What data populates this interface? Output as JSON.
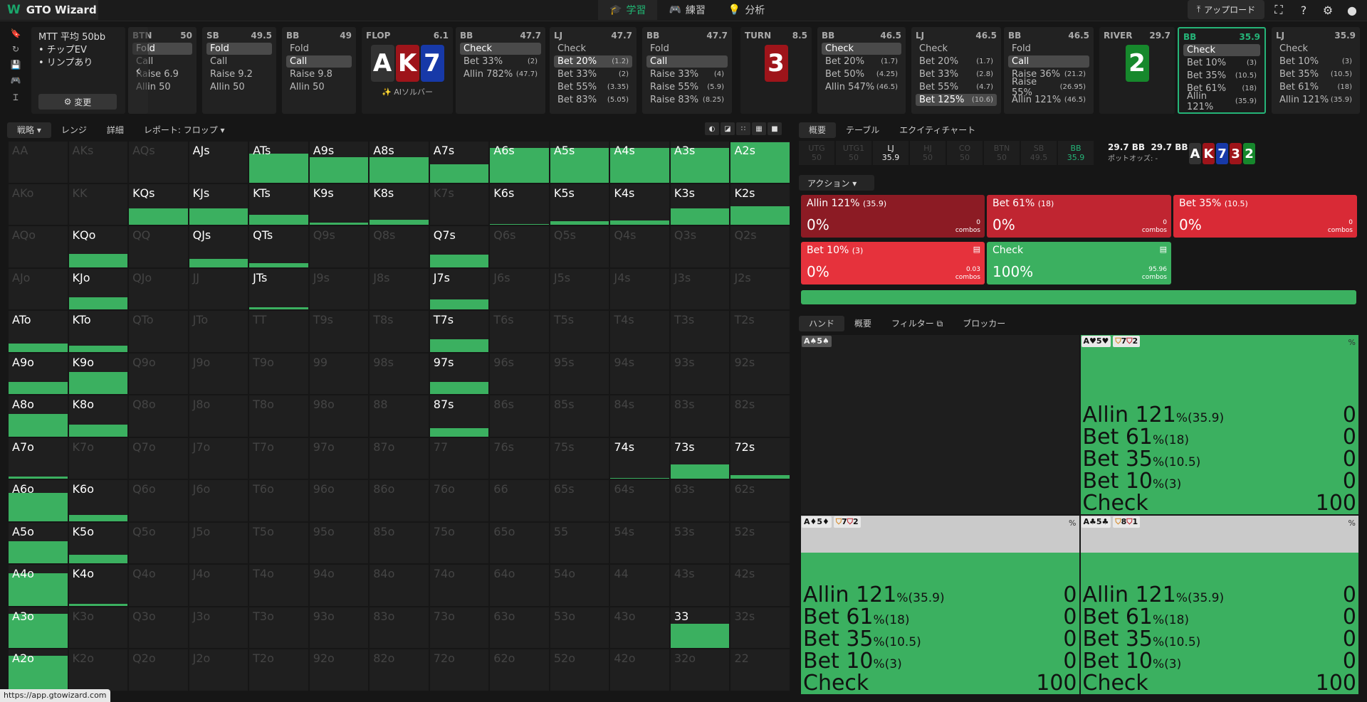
{
  "app": {
    "name": "GTO Wizard"
  },
  "nav": [
    {
      "label": "学習",
      "icon": "graduation-cap-icon"
    },
    {
      "label": "練習",
      "icon": "gamepad-icon"
    },
    {
      "label": "分析",
      "icon": "lightbulb-icon"
    }
  ],
  "upload_label": "アップロード",
  "mtt": {
    "title": "MTT 平均 50bb",
    "line1": "• チップEV",
    "line2": "• リンプあり",
    "change": "変更"
  },
  "nodes": [
    {
      "pos": "BTN",
      "stack": "50",
      "acts": [
        {
          "a": "Fold",
          "s": "",
          "hl": true
        },
        {
          "a": "Call",
          "s": ""
        },
        {
          "a": "Raise 6.9",
          "s": ""
        },
        {
          "a": "Allin 50",
          "s": ""
        }
      ]
    },
    {
      "pos": "SB",
      "stack": "49.5",
      "acts": [
        {
          "a": "Fold",
          "s": "",
          "hl": true
        },
        {
          "a": "Call",
          "s": ""
        },
        {
          "a": "Raise 9.2",
          "s": ""
        },
        {
          "a": "Allin 50",
          "s": ""
        }
      ]
    },
    {
      "pos": "BB",
      "stack": "49",
      "acts": [
        {
          "a": "Fold",
          "s": ""
        },
        {
          "a": "Call",
          "s": "",
          "hl": true
        },
        {
          "a": "Raise 9.8",
          "s": ""
        },
        {
          "a": "Allin 50",
          "s": ""
        }
      ]
    },
    {
      "pos": "BB",
      "stack": "47.7",
      "acts": [
        {
          "a": "Check",
          "s": "",
          "hl": true
        },
        {
          "a": "Bet 33%",
          "s": "(2)"
        },
        {
          "a": "Allin 782%",
          "s": "(47.7)"
        }
      ]
    },
    {
      "pos": "LJ",
      "stack": "47.7",
      "acts": [
        {
          "a": "Check",
          "s": ""
        },
        {
          "a": "Bet 20%",
          "s": "(1.2)",
          "hl": true
        },
        {
          "a": "Bet 33%",
          "s": "(2)"
        },
        {
          "a": "Bet 55%",
          "s": "(3.35)"
        },
        {
          "a": "Bet 83%",
          "s": "(5.05)"
        }
      ]
    },
    {
      "pos": "BB",
      "stack": "47.7",
      "acts": [
        {
          "a": "Fold",
          "s": ""
        },
        {
          "a": "Call",
          "s": "",
          "hl": true
        },
        {
          "a": "Raise 33%",
          "s": "(4)"
        },
        {
          "a": "Raise 55%",
          "s": "(5.9)"
        },
        {
          "a": "Raise 83%",
          "s": "(8.25)"
        }
      ]
    },
    {
      "pos": "BB",
      "stack": "46.5",
      "acts": [
        {
          "a": "Check",
          "s": "",
          "hl": true
        },
        {
          "a": "Bet 20%",
          "s": "(1.7)"
        },
        {
          "a": "Bet 50%",
          "s": "(4.25)"
        },
        {
          "a": "Allin 547%",
          "s": "(46.5)"
        }
      ]
    },
    {
      "pos": "LJ",
      "stack": "46.5",
      "acts": [
        {
          "a": "Check",
          "s": ""
        },
        {
          "a": "Bet 20%",
          "s": "(1.7)"
        },
        {
          "a": "Bet 33%",
          "s": "(2.8)"
        },
        {
          "a": "Bet 55%",
          "s": "(4.7)"
        },
        {
          "a": "Bet 125%",
          "s": "(10.6)",
          "hl": true
        }
      ]
    },
    {
      "pos": "BB",
      "stack": "46.5",
      "acts": [
        {
          "a": "Fold",
          "s": ""
        },
        {
          "a": "Call",
          "s": "",
          "hl": true
        },
        {
          "a": "Raise 36%",
          "s": "(21.2)"
        },
        {
          "a": "Raise 55%",
          "s": "(26.95)"
        },
        {
          "a": "Allin 121%",
          "s": "(46.5)"
        }
      ]
    },
    {
      "pos": "BB",
      "stack": "35.9",
      "acts": [
        {
          "a": "Check",
          "s": "",
          "hl": true
        },
        {
          "a": "Bet 10%",
          "s": "(3)"
        },
        {
          "a": "Bet 35%",
          "s": "(10.5)"
        },
        {
          "a": "Bet 61%",
          "s": "(18)"
        },
        {
          "a": "Allin 121%",
          "s": "(35.9)"
        }
      ]
    },
    {
      "pos": "LJ",
      "stack": "35.9",
      "acts": [
        {
          "a": "Check",
          "s": ""
        },
        {
          "a": "Bet 10%",
          "s": "(3)"
        },
        {
          "a": "Bet 35%",
          "s": "(10.5)"
        },
        {
          "a": "Bet 61%",
          "s": "(18)"
        },
        {
          "a": "Allin 121%",
          "s": "(35.9)"
        }
      ]
    }
  ],
  "streets": {
    "flop": {
      "name": "FLOP",
      "pot": "6.1",
      "cards": [
        {
          "r": "A",
          "s": "s"
        },
        {
          "r": "K",
          "s": "h"
        },
        {
          "r": "7",
          "s": "d"
        }
      ],
      "ai": "AIソルバー"
    },
    "turn": {
      "name": "TURN",
      "pot": "8.5",
      "cards": [
        {
          "r": "3",
          "s": "h"
        }
      ]
    },
    "river": {
      "name": "RIVER",
      "pot": "29.7",
      "cards": [
        {
          "r": "2",
          "s": "c"
        }
      ]
    }
  },
  "left_tabs": [
    {
      "label": "戦略 ▾"
    },
    {
      "label": "レンジ"
    },
    {
      "label": "詳細"
    },
    {
      "label": "レポート: フロップ ▾"
    }
  ],
  "matrix": {
    "labels": [
      [
        "AA",
        "AKs",
        "AQs",
        "AJs",
        "ATs",
        "A9s",
        "A8s",
        "A7s",
        "A6s",
        "A5s",
        "A4s",
        "A3s",
        "A2s"
      ],
      [
        "AKo",
        "KK",
        "KQs",
        "KJs",
        "KTs",
        "K9s",
        "K8s",
        "K7s",
        "K6s",
        "K5s",
        "K4s",
        "K3s",
        "K2s"
      ],
      [
        "AQo",
        "KQo",
        "QQ",
        "QJs",
        "QTs",
        "Q9s",
        "Q8s",
        "Q7s",
        "Q6s",
        "Q5s",
        "Q4s",
        "Q3s",
        "Q2s"
      ],
      [
        "AJo",
        "KJo",
        "QJo",
        "JJ",
        "JTs",
        "J9s",
        "J8s",
        "J7s",
        "J6s",
        "J5s",
        "J4s",
        "J3s",
        "J2s"
      ],
      [
        "ATo",
        "KTo",
        "QTo",
        "JTo",
        "TT",
        "T9s",
        "T8s",
        "T7s",
        "T6s",
        "T5s",
        "T4s",
        "T3s",
        "T2s"
      ],
      [
        "A9o",
        "K9o",
        "Q9o",
        "J9o",
        "T9o",
        "99",
        "98s",
        "97s",
        "96s",
        "95s",
        "94s",
        "93s",
        "92s"
      ],
      [
        "A8o",
        "K8o",
        "Q8o",
        "J8o",
        "T8o",
        "98o",
        "88",
        "87s",
        "86s",
        "85s",
        "84s",
        "83s",
        "82s"
      ],
      [
        "A7o",
        "K7o",
        "Q7o",
        "J7o",
        "T7o",
        "97o",
        "87o",
        "77",
        "76s",
        "75s",
        "74s",
        "73s",
        "72s"
      ],
      [
        "A6o",
        "K6o",
        "Q6o",
        "J6o",
        "T6o",
        "96o",
        "86o",
        "76o",
        "66",
        "65s",
        "64s",
        "63s",
        "62s"
      ],
      [
        "A5o",
        "K5o",
        "Q5o",
        "J5o",
        "T5o",
        "95o",
        "85o",
        "75o",
        "65o",
        "55",
        "54s",
        "53s",
        "52s"
      ],
      [
        "A4o",
        "K4o",
        "Q4o",
        "J4o",
        "T4o",
        "94o",
        "84o",
        "74o",
        "64o",
        "54o",
        "44",
        "43s",
        "42s"
      ],
      [
        "A3o",
        "K3o",
        "Q3o",
        "J3o",
        "T3o",
        "93o",
        "83o",
        "73o",
        "63o",
        "53o",
        "43o",
        "33",
        "32s"
      ],
      [
        "A2o",
        "K2o",
        "Q2o",
        "J2o",
        "T2o",
        "92o",
        "82o",
        "72o",
        "62o",
        "52o",
        "42o",
        "32o",
        "22"
      ]
    ],
    "fill": [
      [
        0,
        0,
        0,
        0,
        0.7,
        0.62,
        0.62,
        0.45,
        0.85,
        0.85,
        0.85,
        0.85,
        0.98
      ],
      [
        0,
        0,
        0.4,
        0.4,
        0.25,
        0.05,
        0.12,
        0,
        0.02,
        0.08,
        0.1,
        0.4,
        0.45
      ],
      [
        0,
        0.32,
        0,
        0.2,
        0.1,
        0,
        0,
        0.3,
        0,
        0,
        0,
        0,
        0
      ],
      [
        0,
        0.3,
        0,
        0,
        0.05,
        0,
        0,
        0.25,
        0,
        0,
        0,
        0,
        0
      ],
      [
        0.2,
        0.15,
        0,
        0,
        0,
        0,
        0,
        0.3,
        0,
        0,
        0,
        0,
        0
      ],
      [
        0.3,
        0.55,
        0,
        0,
        0,
        0,
        0,
        0.3,
        0,
        0,
        0,
        0,
        0
      ],
      [
        0.55,
        0.3,
        0,
        0,
        0,
        0,
        0,
        0.2,
        0,
        0,
        0,
        0,
        0
      ],
      [
        0.05,
        0,
        0,
        0,
        0,
        0,
        0,
        0,
        0,
        0,
        0.02,
        0.35,
        0.1
      ],
      [
        0.7,
        0.15,
        0,
        0,
        0,
        0,
        0,
        0,
        0,
        0,
        0,
        0,
        0
      ],
      [
        0.55,
        0.22,
        0,
        0,
        0,
        0,
        0,
        0,
        0,
        0,
        0,
        0,
        0
      ],
      [
        0.8,
        0.05,
        0,
        0,
        0,
        0,
        0,
        0,
        0,
        0,
        0,
        0,
        0
      ],
      [
        0.85,
        0,
        0,
        0,
        0,
        0,
        0,
        0,
        0,
        0,
        0,
        0.6,
        0
      ],
      [
        0.85,
        0,
        0,
        0,
        0,
        0,
        0,
        0,
        0,
        0,
        0,
        0,
        0
      ]
    ],
    "bright": [
      [
        3,
        4,
        5,
        6,
        7,
        8,
        9,
        10,
        11,
        12
      ],
      [
        2,
        3,
        4,
        5,
        6,
        8,
        9,
        10,
        11,
        12
      ],
      [
        1,
        3,
        4,
        7
      ],
      [
        1,
        4,
        7
      ],
      [
        0,
        1,
        7
      ],
      [
        0,
        1,
        7
      ],
      [
        0,
        1,
        7
      ],
      [
        0,
        10,
        11,
        12
      ],
      [
        0,
        1
      ],
      [
        0,
        1
      ],
      [
        0,
        1
      ],
      [
        0,
        11
      ],
      [
        0
      ]
    ]
  },
  "right_tabs": [
    {
      "label": "概要"
    },
    {
      "label": "テーブル"
    },
    {
      "label": "エクイティチャート"
    }
  ],
  "positions": [
    {
      "n": "UTG",
      "v": "50"
    },
    {
      "n": "UTG1",
      "v": "50"
    },
    {
      "n": "LJ",
      "v": "35.9"
    },
    {
      "n": "HJ",
      "v": "50"
    },
    {
      "n": "CO",
      "v": "50"
    },
    {
      "n": "BTN",
      "v": "50"
    },
    {
      "n": "SB",
      "v": "49.5"
    },
    {
      "n": "BB",
      "v": "35.9"
    }
  ],
  "pot": {
    "a": "29.7 BB",
    "b": "29.7 BB",
    "label": "ポットオッズ: -"
  },
  "board": [
    {
      "r": "A",
      "s": "s"
    },
    {
      "r": "K",
      "s": "h"
    },
    {
      "r": "7",
      "s": "d"
    },
    {
      "r": "3",
      "s": "h"
    },
    {
      "r": "2",
      "s": "c"
    }
  ],
  "action_dropdown": "アクション ▾",
  "actions": [
    {
      "t": "Allin 121%",
      "s": "(35.9)",
      "p": "0%",
      "c": "0",
      "color": "#8c1b24"
    },
    {
      "t": "Bet 61%",
      "s": "(18)",
      "p": "0%",
      "c": "0",
      "color": "#c02531"
    },
    {
      "t": "Bet 35%",
      "s": "(10.5)",
      "p": "0%",
      "c": "0",
      "color": "#d92a36"
    },
    {
      "t": "Bet 10%",
      "s": "(3)",
      "p": "0%",
      "c": "0.03",
      "color": "#e6323c"
    },
    {
      "t": "Check",
      "s": "",
      "p": "100%",
      "c": "95.96",
      "color": "#3bb060"
    }
  ],
  "combos_label": "combos",
  "hand_tabs": [
    {
      "label": "ハンド"
    },
    {
      "label": "概要"
    },
    {
      "label": "フィルター ⧉"
    },
    {
      "label": "ブロッカー"
    }
  ],
  "hands": [
    {
      "combo": "A♠5♠",
      "empty": true
    },
    {
      "combo": "A♥5♥",
      "b1": "7",
      "b2": "2",
      "pct": "%",
      "lines": [
        {
          "a": "Allin 121",
          "s": "%(35.9)",
          "v": "0"
        },
        {
          "a": "Bet 61",
          "s": "%(18)",
          "v": "0"
        },
        {
          "a": "Bet 35",
          "s": "%(10.5)",
          "v": "0"
        },
        {
          "a": "Bet 10",
          "s": "%(3)",
          "v": "0"
        },
        {
          "a": "Check",
          "s": "",
          "v": "100"
        }
      ]
    },
    {
      "combo": "A♦5♦",
      "b1": "7",
      "b2": "2",
      "pct": "%",
      "gray": true,
      "lines": [
        {
          "a": "Allin 121",
          "s": "%(35.9)",
          "v": "0"
        },
        {
          "a": "Bet 61",
          "s": "%(18)",
          "v": "0"
        },
        {
          "a": "Bet 35",
          "s": "%(10.5)",
          "v": "0"
        },
        {
          "a": "Bet 10",
          "s": "%(3)",
          "v": "0"
        },
        {
          "a": "Check",
          "s": "",
          "v": "100"
        }
      ]
    },
    {
      "combo": "A♣5♣",
      "b1": "8",
      "b2": "1",
      "pct": "%",
      "gray": true,
      "lines": [
        {
          "a": "Allin 121",
          "s": "%(35.9)",
          "v": "0"
        },
        {
          "a": "Bet 61",
          "s": "%(18)",
          "v": "0"
        },
        {
          "a": "Bet 35",
          "s": "%(10.5)",
          "v": "0"
        },
        {
          "a": "Bet 10",
          "s": "%(3)",
          "v": "0"
        },
        {
          "a": "Check",
          "s": "",
          "v": "100"
        }
      ]
    }
  ],
  "status_url": "https://app.gtowizard.com"
}
